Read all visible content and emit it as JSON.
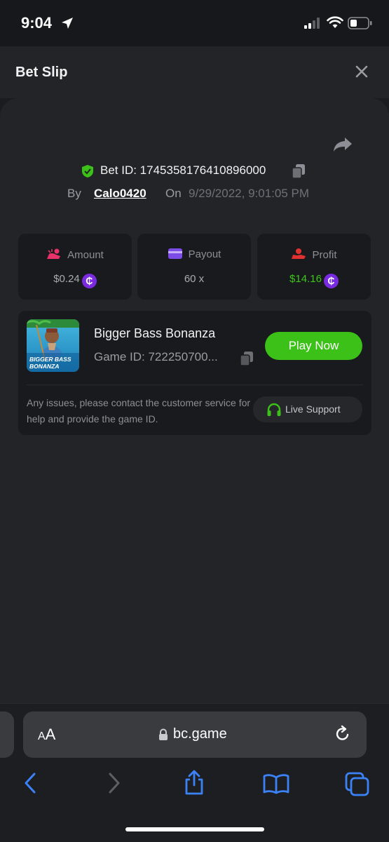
{
  "status_bar": {
    "time": "9:04"
  },
  "header": {
    "title": "Bet Slip"
  },
  "bet": {
    "id_label": "Bet ID: 1745358176410896000",
    "by_label": "By",
    "username": "Calo0420",
    "on_label": "On",
    "datetime": "9/29/2022, 9:01:05 PM"
  },
  "stats": [
    {
      "label": "Amount",
      "value": "$0.24",
      "icon": "amount-icon"
    },
    {
      "label": "Payout",
      "value": "60 x",
      "icon": "card-icon"
    },
    {
      "label": "Profit",
      "value": "$14.16",
      "icon": "profit-icon"
    }
  ],
  "coin_symbol": "₵",
  "game": {
    "name": "Bigger Bass Bonanza",
    "id_label": "Game ID: 722250700...",
    "play_label": "Play Now",
    "thumb_text_1": "BIGGER BASS",
    "thumb_text_2": "BONANZA"
  },
  "support": {
    "message": "Any issues, please contact the customer service for help and provide the game ID.",
    "button_label": "Live Support"
  },
  "browser": {
    "aa_small": "A",
    "aa_large": "A",
    "url": "bc.game"
  },
  "colors": {
    "accent_green": "#3bc117",
    "profit_green": "#3dc51a",
    "coin_purple": "#7a2be0",
    "ios_blue": "#3b82f6"
  }
}
